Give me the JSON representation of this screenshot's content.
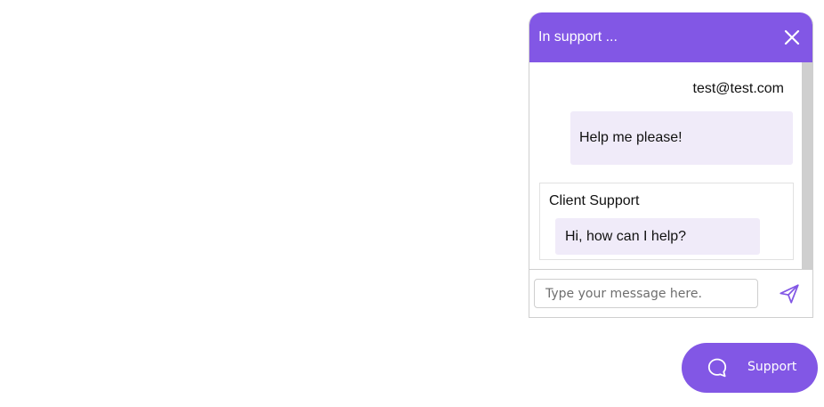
{
  "chat": {
    "title": "In support ...",
    "close_icon": "close-icon",
    "messages": {
      "user": {
        "email": "test@test.com",
        "text": "Help me please!"
      },
      "support": {
        "name": "Client Support",
        "text": "Hi, how can I help?"
      }
    },
    "input": {
      "value": "",
      "placeholder": "Type your message here."
    },
    "send_icon": "send-icon"
  },
  "launcher": {
    "label": "Support",
    "icon": "chat-bubble-icon"
  },
  "colors": {
    "accent": "#8257e5",
    "bubble": "#f0ebf9",
    "border": "#cfcfcf"
  }
}
